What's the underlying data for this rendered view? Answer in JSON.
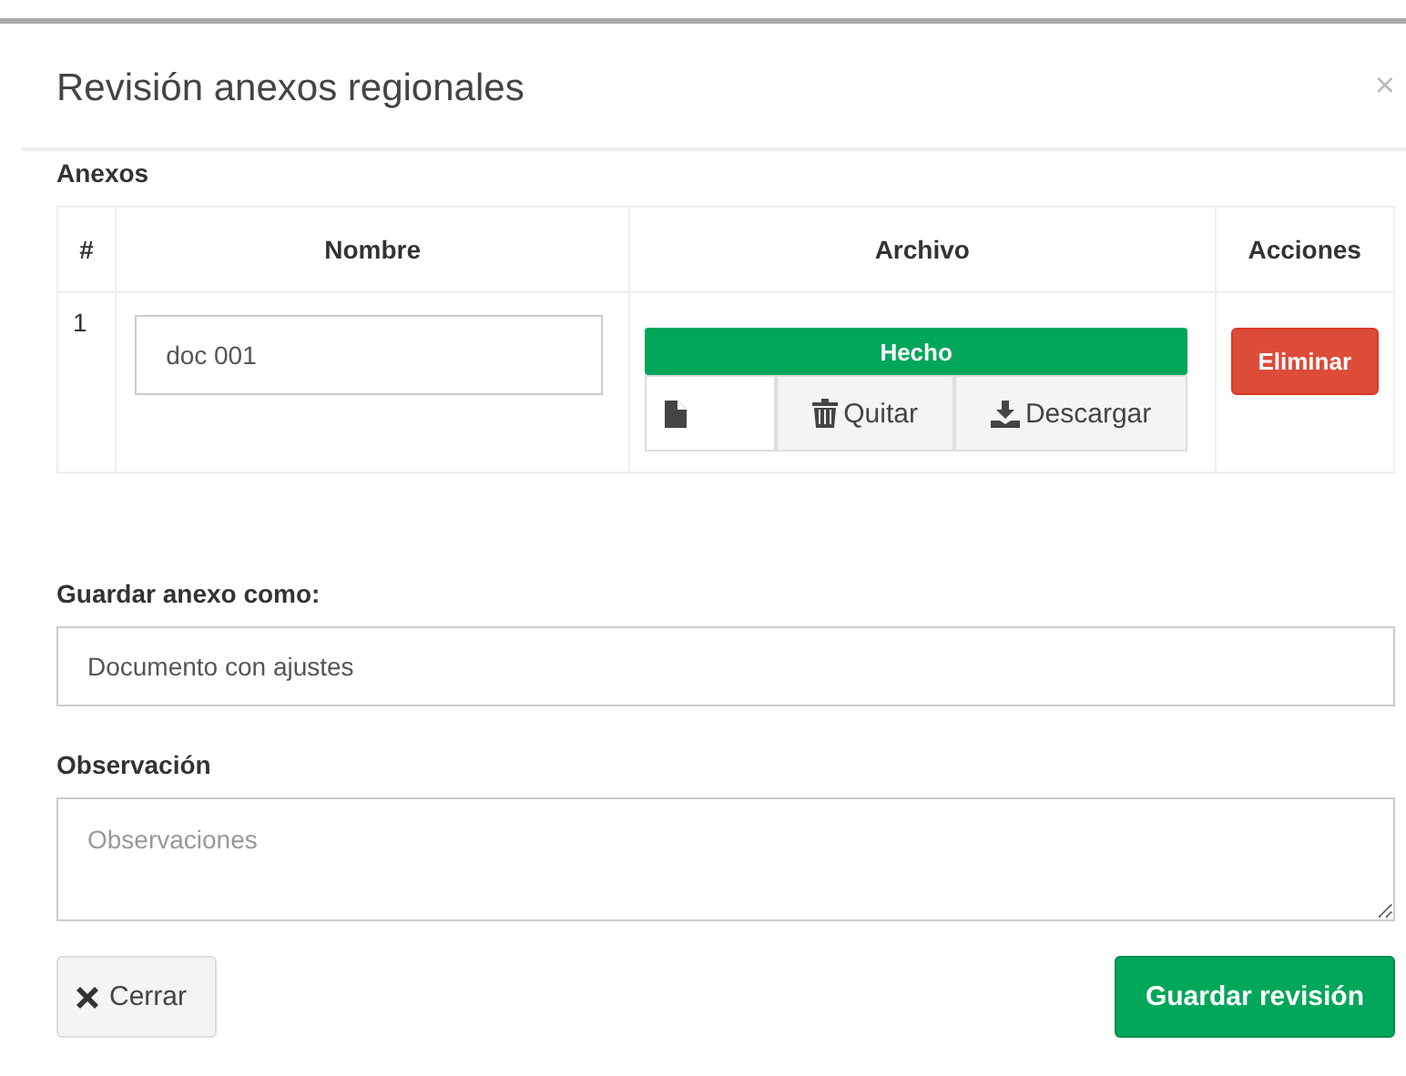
{
  "dialog": {
    "title": "Revisión anexos regionales",
    "close_symbol": "×"
  },
  "annexes": {
    "heading": "Anexos",
    "columns": [
      "#",
      "Nombre",
      "Archivo",
      "Acciones"
    ],
    "rows": [
      {
        "number": "1",
        "name": "doc 001",
        "upload": {
          "status": "Hecho",
          "level": 1,
          "remove": "Quitar",
          "download": "Descargar"
        },
        "delete": "Eliminar"
      }
    ]
  },
  "save_as": {
    "label": "Guardar anexo como:",
    "value": "Documento con ajustes"
  },
  "observation": {
    "label": "Observación",
    "placeholder": "Observaciones"
  },
  "footer": {
    "close": "Cerrar",
    "save": "Guardar revisión"
  }
}
